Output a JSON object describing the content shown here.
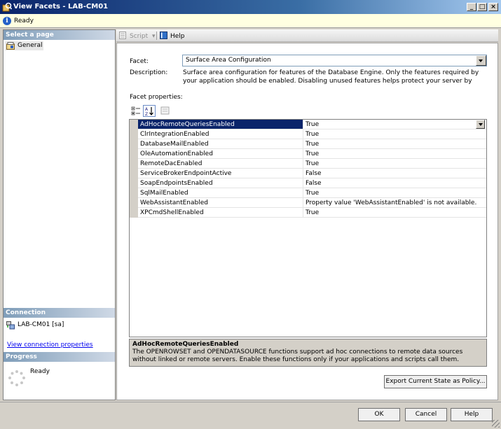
{
  "window": {
    "title": "View Facets - LAB-CM01",
    "buttons": {
      "minimize": "_",
      "maximize": "□",
      "close": "×"
    }
  },
  "status": {
    "text": "Ready",
    "icon": "info-icon"
  },
  "left": {
    "select_page_header": "Select a page",
    "pages": [
      {
        "label": "General",
        "icon": "general-page-icon"
      }
    ],
    "connection_header": "Connection",
    "connection_value": "LAB-CM01 [sa]",
    "view_connection_link": "View connection properties",
    "progress_header": "Progress",
    "progress_status": "Ready"
  },
  "toolbar": {
    "script_label": "Script",
    "help_label": "Help"
  },
  "form": {
    "facet_label": "Facet:",
    "facet_value": "Surface Area Configuration",
    "description_label": "Description:",
    "description_text": "Surface area configuration for features of the Database Engine. Only the features required by your application should be enabled. Disabling unused features helps protect your server by reducing the surface",
    "facet_properties_label": "Facet properties:"
  },
  "properties": [
    {
      "name": "AdHocRemoteQueriesEnabled",
      "value": "True"
    },
    {
      "name": "ClrIntegrationEnabled",
      "value": "True"
    },
    {
      "name": "DatabaseMailEnabled",
      "value": "True"
    },
    {
      "name": "OleAutomationEnabled",
      "value": "True"
    },
    {
      "name": "RemoteDacEnabled",
      "value": "True"
    },
    {
      "name": "ServiceBrokerEndpointActive",
      "value": "False"
    },
    {
      "name": "SoapEndpointsEnabled",
      "value": "False"
    },
    {
      "name": "SqlMailEnabled",
      "value": "True"
    },
    {
      "name": "WebAssistantEnabled",
      "value": "Property value 'WebAssistantEnabled' is not available."
    },
    {
      "name": "XPCmdShellEnabled",
      "value": "True"
    }
  ],
  "help_panel": {
    "title": "AdHocRemoteQueriesEnabled",
    "text": "The OPENROWSET and OPENDATASOURCE functions support ad hoc connections to remote data sources without linked or remote servers. Enable these functions only if your applications and scripts call them."
  },
  "buttons": {
    "export": "Export Current State as Policy...",
    "ok": "OK",
    "cancel": "Cancel",
    "help": "Help"
  },
  "colors": {
    "selection": "#0a246a",
    "title_start": "#0a246a",
    "status_bg": "#ffffe1"
  }
}
